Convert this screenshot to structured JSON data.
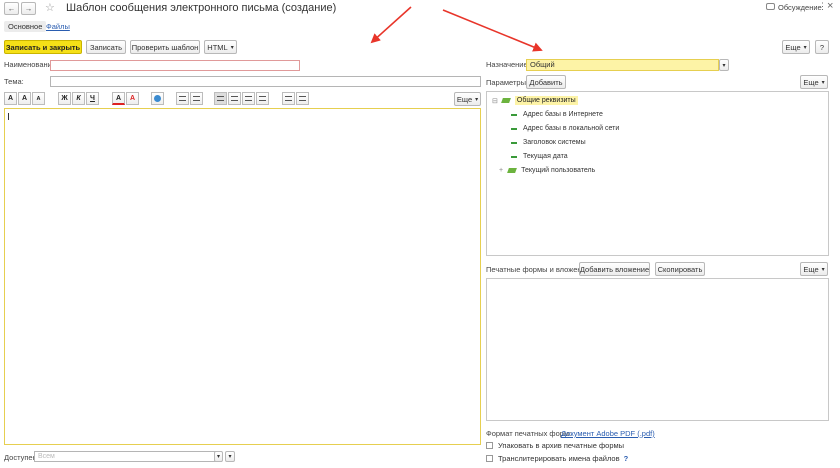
{
  "window": {
    "title": "Шаблон сообщения электронного письма (создание)",
    "discuss_label": "Обсуждение",
    "nav_back": "←",
    "nav_forward": "→",
    "star": "☆",
    "more_dots": "⋮",
    "close": "×"
  },
  "tabs": [
    {
      "label": "Основное"
    },
    {
      "label": "Файлы"
    }
  ],
  "toolbar": {
    "save_close": "Записать и закрыть",
    "save": "Записать",
    "check": "Проверить шаблон",
    "html": "HTML",
    "more": "Еще",
    "help": "?"
  },
  "form": {
    "name_label": "Наименование:",
    "name_value": "",
    "subject_label": "Тема:",
    "subject_value": "",
    "purpose_label": "Назначение:",
    "purpose_value": "Общий",
    "params_label": "Параметры:",
    "add_button": "Добавить",
    "more": "Еще",
    "access_label": "Доступен:",
    "access_placeholder": "Всем"
  },
  "format_toolbar": {
    "buttons": [
      "A",
      "A",
      "A",
      "Ж",
      "К",
      "Ч",
      "A",
      "A"
    ],
    "more": "Еще"
  },
  "tree": {
    "root": "Общие реквизиты",
    "items": [
      "Адрес базы в Интернете",
      "Адрес базы в локальной сети",
      "Заголовок системы",
      "Текущая дата"
    ],
    "user": "Текущий пользователь",
    "expand_minus": "⊟",
    "expand_plus": "+"
  },
  "attachments": {
    "label": "Печатные формы и вложения:",
    "add": "Добавить вложение",
    "copy": "Скопировать",
    "more": "Еще"
  },
  "footer": {
    "format_label": "Формат печатных форм:",
    "format_link": "Документ Adobe PDF (.pdf)",
    "zip_label": "Упаковать в архив печатные формы",
    "translit_label": "Транслитерировать имена файлов",
    "help": "?"
  },
  "colors": {
    "arrow": "#e8352a",
    "primary_button": "#f5e017",
    "highlight": "#fdf3a6"
  }
}
